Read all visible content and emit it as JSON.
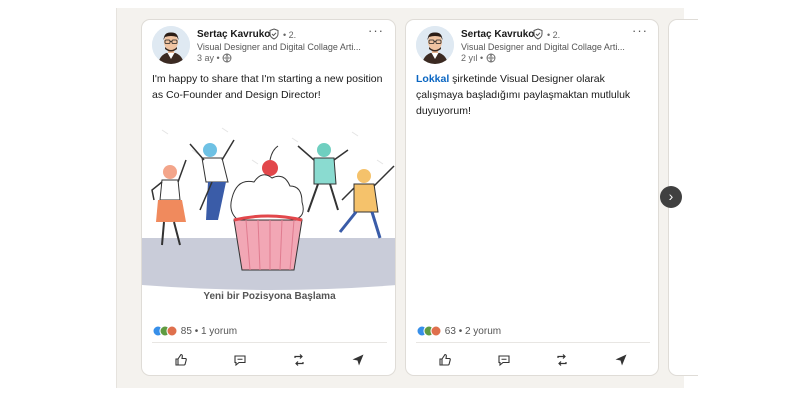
{
  "carousel": {
    "next_label": "›"
  },
  "posts": [
    {
      "author": "Sertaç Kavruko",
      "degree": "• 2.",
      "headline": "Visual Designer and Digital Collage Arti...",
      "time": "3 ay •",
      "more": "···",
      "text": "I'm happy to share that I'm starting a new position as Co-Founder and Design Director!",
      "image_caption": "Yeni bir Pozisyona Başlama",
      "reaction_count": "85",
      "comments": "• 1 yorum"
    },
    {
      "author": "Sertaç Kavruko",
      "degree": "• 2.",
      "headline": "Visual Designer and Digital Collage Arti...",
      "time": "2 yıl •",
      "more": "···",
      "mention": "Lokkal",
      "text": " şirketinde Visual Designer olarak çalışmaya başladığımı paylaşmaktan mutluluk duyuyorum!",
      "reaction_count": "63",
      "comments": "• 2 yorum"
    }
  ],
  "actions": [
    "like-icon",
    "comment-icon",
    "repost-icon",
    "send-icon"
  ],
  "colors": {
    "link": "#0a66c2",
    "next_button": "#404040",
    "background_strip": "#f4f2ee"
  }
}
